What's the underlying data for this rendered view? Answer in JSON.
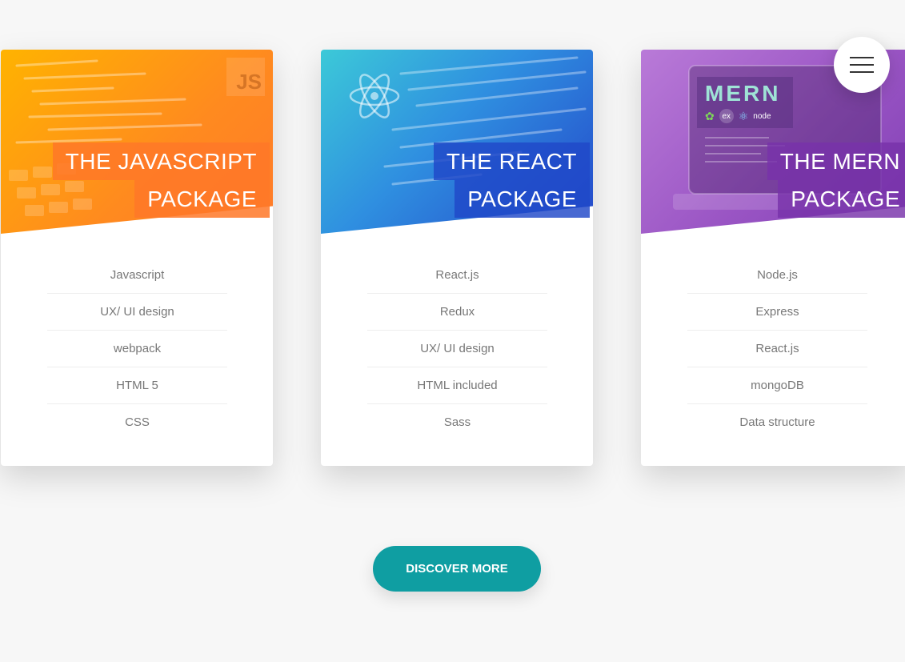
{
  "cards": [
    {
      "title_line1": "THE JAVASCRIPT",
      "title_line2": "PACKAGE",
      "badge": "JS",
      "items": [
        "Javascript",
        "UX/ UI design",
        "webpack",
        "HTML 5",
        "CSS"
      ]
    },
    {
      "title_line1": "THE REACT",
      "title_line2": "PACKAGE",
      "items": [
        "React.js",
        "Redux",
        "UX/ UI design",
        "HTML included",
        "Sass"
      ]
    },
    {
      "title_line1": "THE MERN",
      "title_line2": "PACKAGE",
      "logo_text": "MERN",
      "logo_sub": [
        "ex",
        "node"
      ],
      "items": [
        "Node.js",
        "Express",
        "React.js",
        "mongoDB",
        "Data structure"
      ]
    }
  ],
  "cta": {
    "label": "DISCOVER MORE"
  },
  "colors": {
    "accent": "#0f9ea2",
    "js": "#ff8a1f",
    "react": "#2f6fe0",
    "mern": "#9a55c4"
  },
  "icons": {
    "menu": "hamburger-menu-icon"
  }
}
